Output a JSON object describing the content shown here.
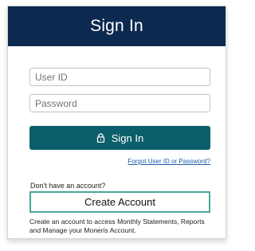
{
  "header": {
    "title": "Sign In"
  },
  "form": {
    "user_id": {
      "placeholder": "User ID",
      "value": ""
    },
    "password": {
      "placeholder": "Password",
      "value": ""
    },
    "signin_label": "Sign In",
    "signin_icon": "lock-icon",
    "forgot_link": "Forgot User ID or Password?"
  },
  "account": {
    "prompt": "Don't have an account?",
    "create_label": "Create Account",
    "description": "Create an account to access Monthly Statements, Reports and Manage your Moneris Account."
  },
  "colors": {
    "header_bg": "#0c2a4f",
    "button_bg": "#0b5e6b",
    "create_border": "#4aa59a",
    "link": "#1b5fa8"
  }
}
